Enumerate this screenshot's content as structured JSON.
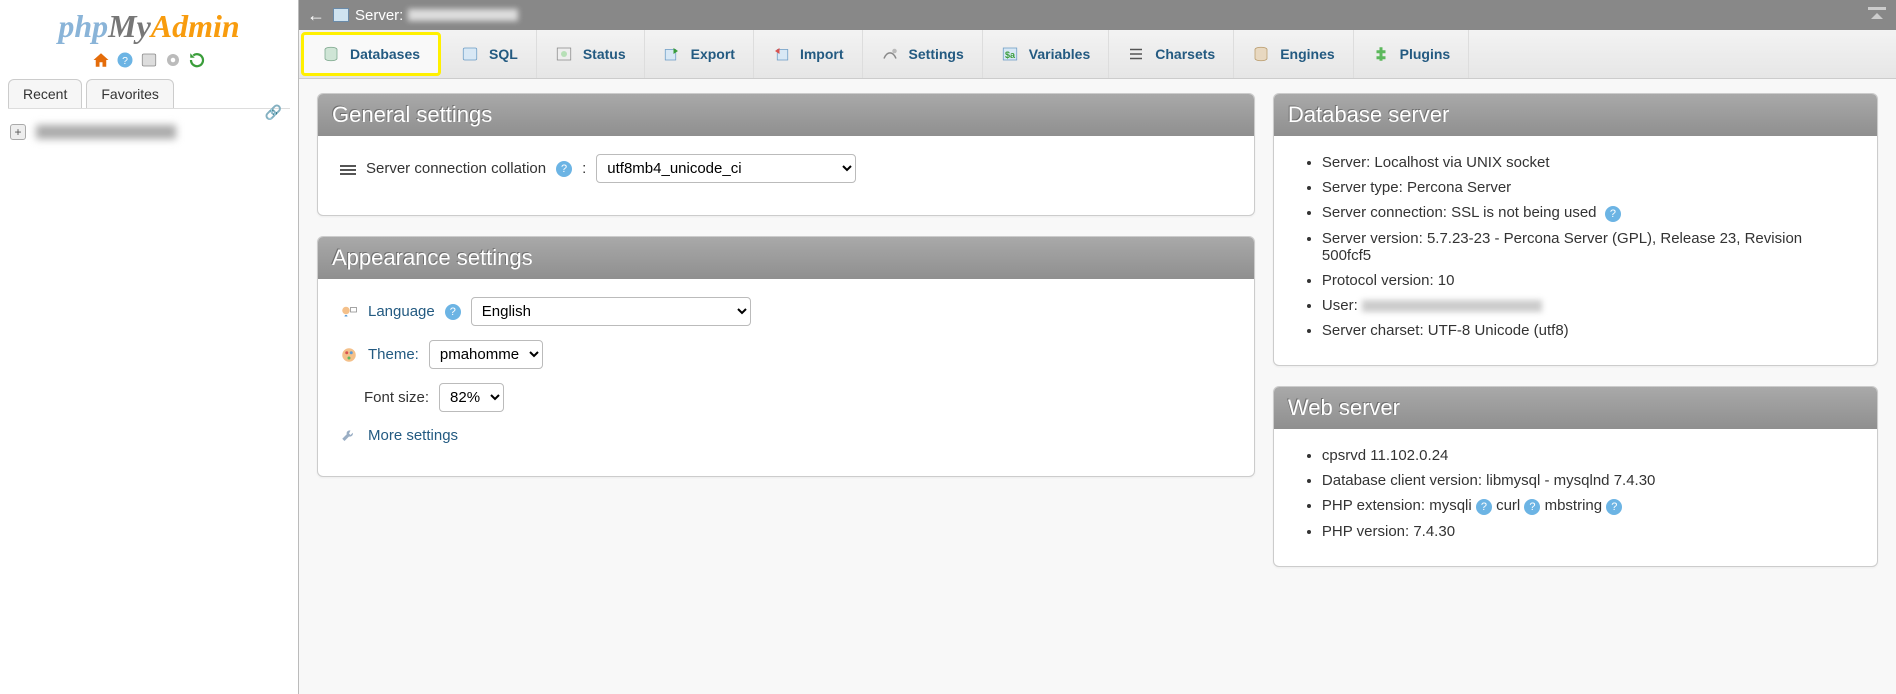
{
  "brand": {
    "php": "php",
    "my": "My",
    "admin": "Admin"
  },
  "sidebar_tabs": {
    "recent": "Recent",
    "favorites": "Favorites"
  },
  "topbar": {
    "label": "Server:",
    "host_hidden": "(redacted)"
  },
  "main_tabs": {
    "databases": "Databases",
    "sql": "SQL",
    "status": "Status",
    "export": "Export",
    "import": "Import",
    "settings": "Settings",
    "variables": "Variables",
    "charsets": "Charsets",
    "engines": "Engines",
    "plugins": "Plugins"
  },
  "panels": {
    "general": {
      "title": "General settings",
      "collation_label": "Server connection collation",
      "collation_value": "utf8mb4_unicode_ci"
    },
    "appearance": {
      "title": "Appearance settings",
      "language_label": "Language",
      "language_value": "English",
      "theme_label": "Theme:",
      "theme_value": "pmahomme",
      "fontsize_label": "Font size:",
      "fontsize_value": "82%",
      "more": "More settings"
    },
    "dbserver": {
      "title": "Database server",
      "items": {
        "server": "Server: Localhost via UNIX socket",
        "type": "Server type: Percona Server",
        "conn": "Server connection: SSL is not being used",
        "version": "Server version: 5.7.23-23 - Percona Server (GPL), Release 23, Revision 500fcf5",
        "proto": "Protocol version: 10",
        "user_lbl": "User:",
        "charset": "Server charset: UTF-8 Unicode (utf8)"
      }
    },
    "webserver": {
      "title": "Web server",
      "items": {
        "cpsrvd": "cpsrvd 11.102.0.24",
        "client": "Database client version: libmysql - mysqlnd 7.4.30",
        "phpext_lbl": "PHP extension:",
        "phpext_1": "mysqli",
        "phpext_2": "curl",
        "phpext_3": "mbstring",
        "phpver": "PHP version: 7.4.30"
      }
    }
  }
}
